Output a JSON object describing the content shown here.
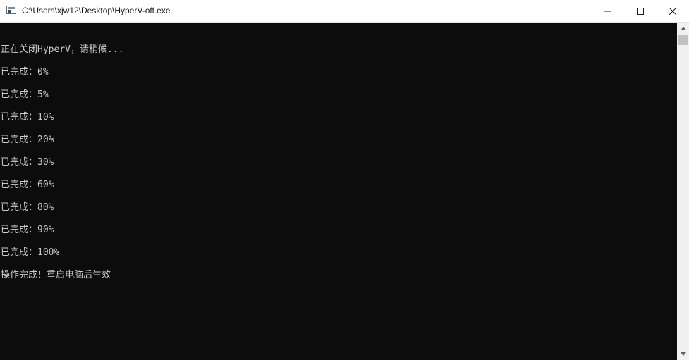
{
  "window": {
    "title": "C:\\Users\\xjw12\\Desktop\\HyperV-off.exe"
  },
  "console": {
    "lines": [
      "正在关闭HyperV，请稍候...",
      "已完成：0%",
      "已完成：5%",
      "已完成：10%",
      "已完成：20%",
      "已完成：30%",
      "已完成：60%",
      "已完成：80%",
      "已完成：90%",
      "已完成：100%",
      "操作完成！重启电脑后生效"
    ]
  },
  "colors": {
    "console_background": "#0c0c0c",
    "console_text": "#cccccc",
    "titlebar_background": "#ffffff"
  },
  "icons": {
    "app": "console-app-icon",
    "minimize": "minimize-icon",
    "maximize": "maximize-icon",
    "close": "close-icon",
    "scroll_up": "scroll-up-arrow-icon",
    "scroll_down": "scroll-down-arrow-icon"
  }
}
